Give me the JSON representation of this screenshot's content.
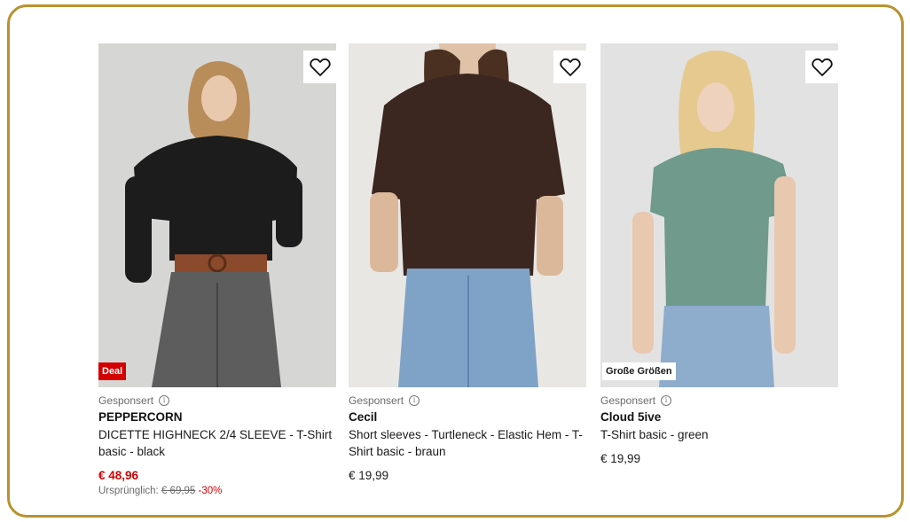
{
  "products": [
    {
      "sponsored_label": "Gesponsert",
      "info_icon": "i",
      "brand": "PEPPERCORN",
      "name": "DICETTE HIGHNECK 2/4 SLEEVE - T-Shirt basic - black",
      "price": "€ 48,96",
      "original_label": "Ursprünglich:",
      "original_price": "€ 69,95",
      "discount": "-30%",
      "badge": "Deal",
      "wishlist_icon": "heart-icon"
    },
    {
      "sponsored_label": "Gesponsert",
      "info_icon": "i",
      "brand": "Cecil",
      "name": "Short sleeves - Turtleneck - Elastic Hem - T-Shirt basic - braun",
      "price": "€ 19,99",
      "wishlist_icon": "heart-icon"
    },
    {
      "sponsored_label": "Gesponsert",
      "info_icon": "i",
      "brand": "Cloud 5ive",
      "name": "T-Shirt basic - green",
      "price": "€ 19,99",
      "badge": "Große Größen",
      "wishlist_icon": "heart-icon"
    }
  ],
  "colors": {
    "frame_border": "#b8922e",
    "sale_red": "#d40000",
    "top_black": "#1c1c1c",
    "top_brown": "#3b2620",
    "top_green": "#6f9a8c"
  }
}
